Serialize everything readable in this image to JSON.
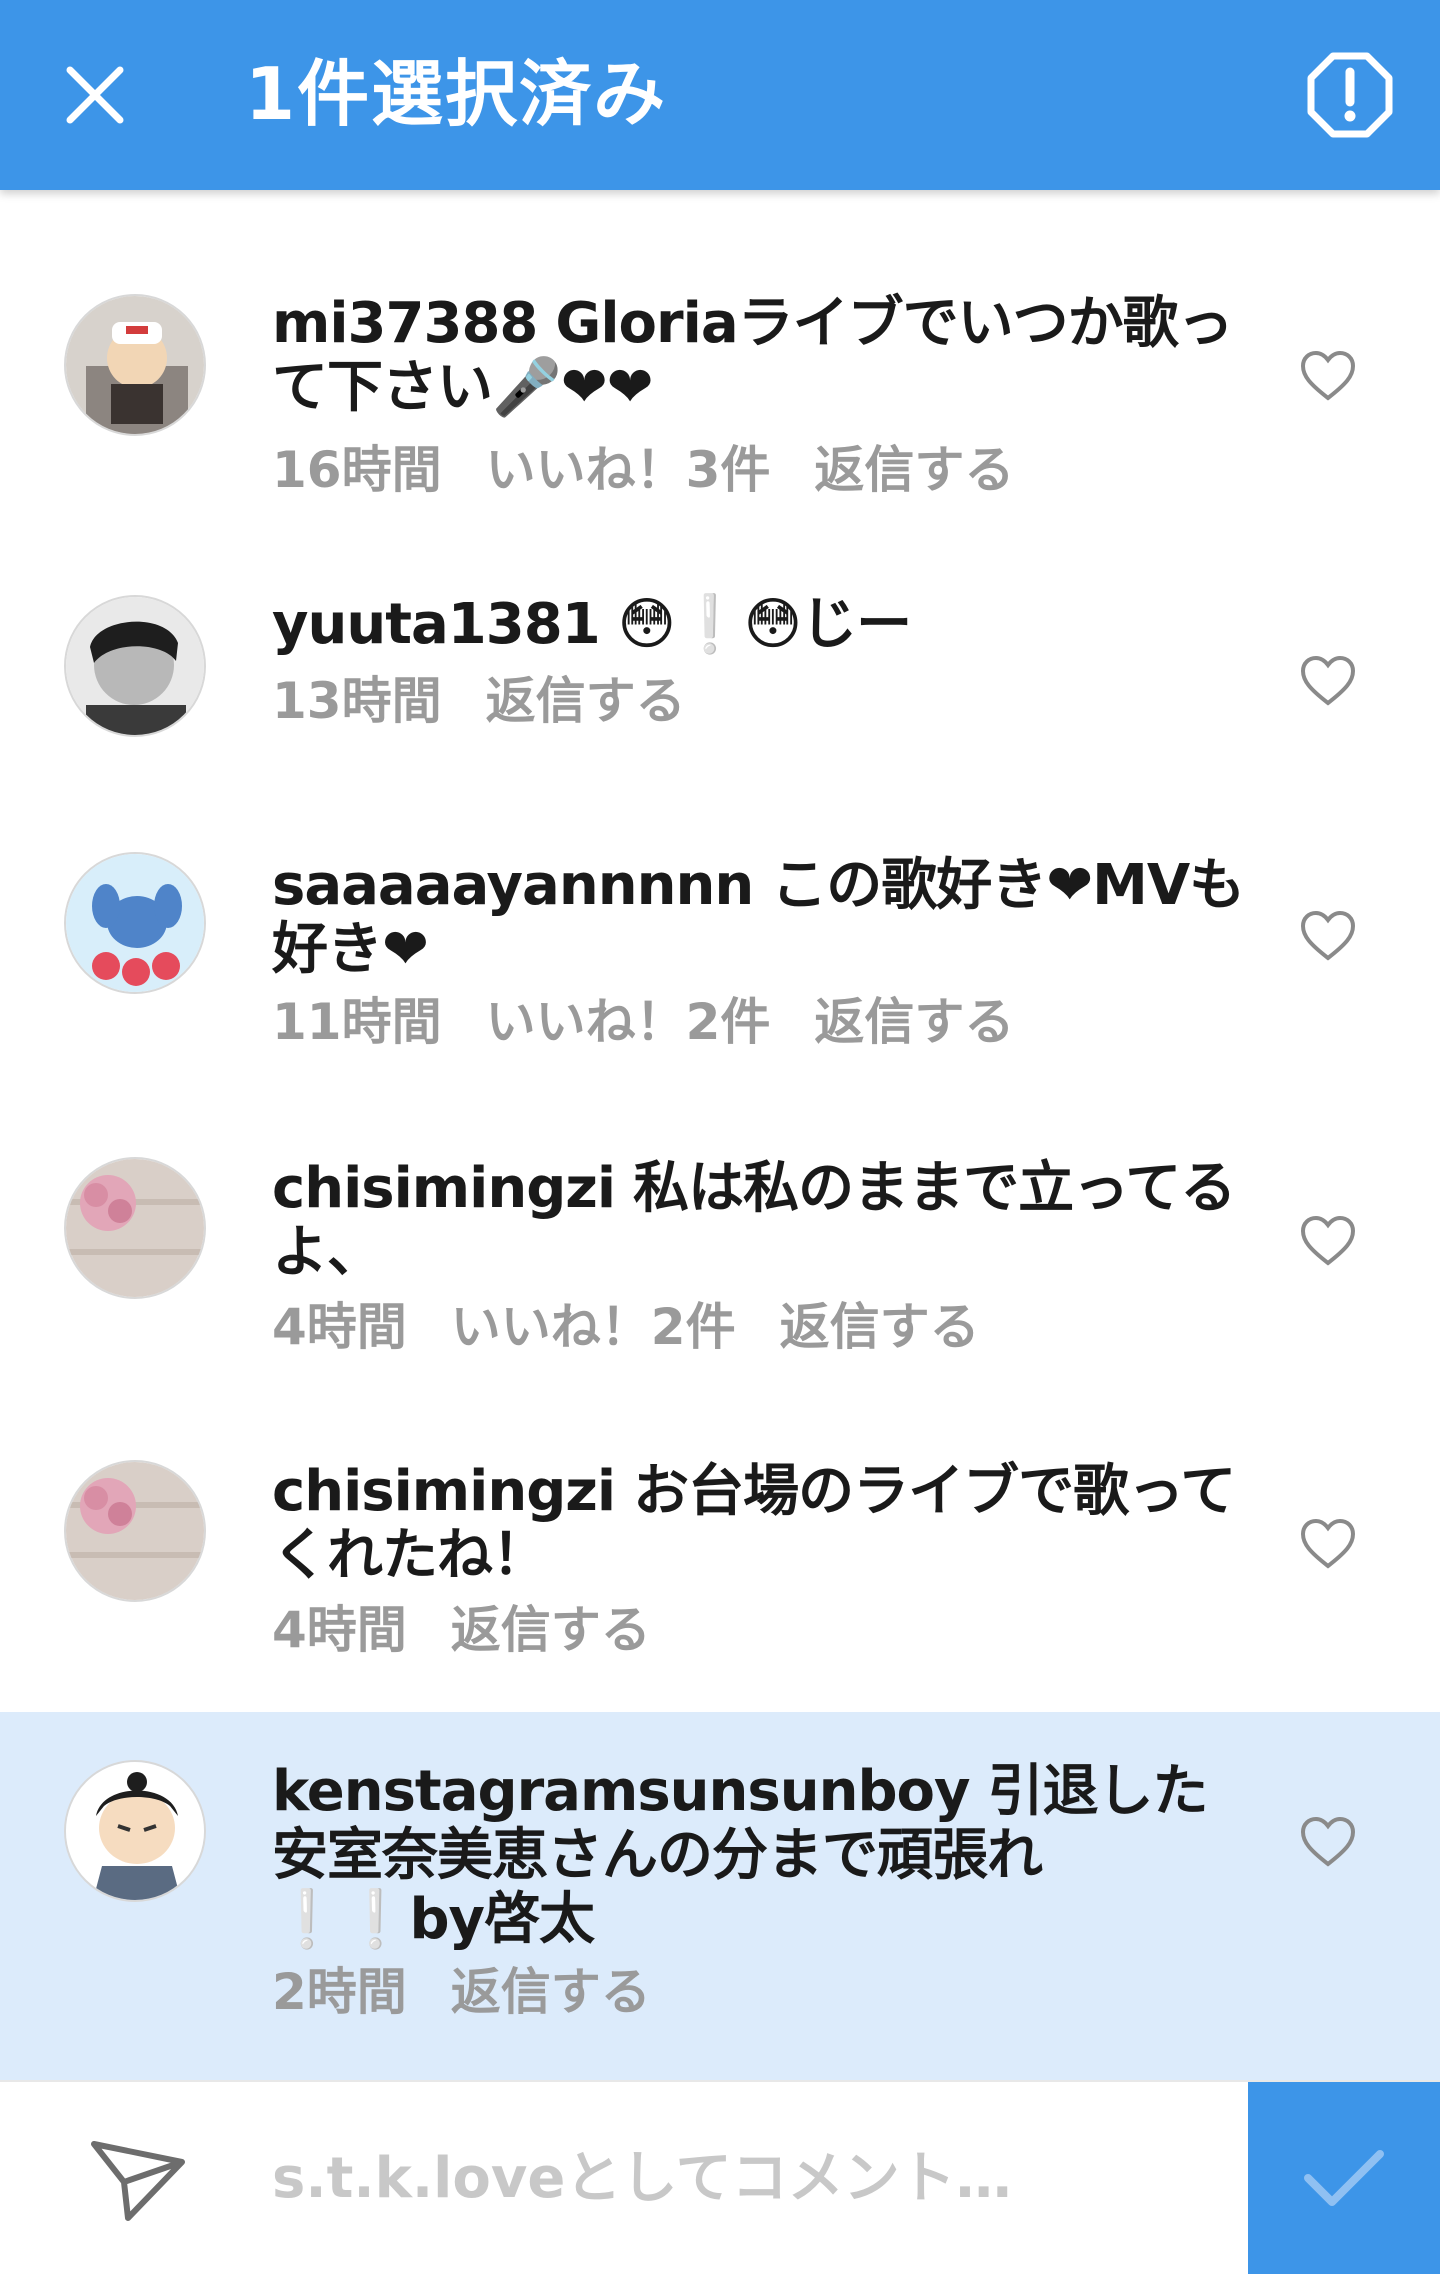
{
  "header": {
    "title": "1件選択済み",
    "close_icon": "close-icon",
    "report_icon": "report-icon"
  },
  "comments": [
    {
      "username": "mi37388",
      "text": "Gloriaライブでいつか歌って下さい🎤❤❤",
      "time": "16時間",
      "likes": "いいね！3件",
      "reply": "返信する"
    },
    {
      "username": "yuuta1381",
      "text": "😳❕😳じー",
      "time": "13時間",
      "reply": "返信する"
    },
    {
      "username": "saaaaayannnnn",
      "text": "この歌好き❤MVも好き❤",
      "time": "11時間",
      "likes": "いいね！2件",
      "reply": "返信する"
    },
    {
      "username": "chisimingzi",
      "text": "私は私のままで立ってるよ、",
      "time": "4時間",
      "likes": "いいね！2件",
      "reply": "返信する"
    },
    {
      "username": "chisimingzi",
      "text": "お台場のライブで歌ってくれたね！",
      "time": "4時間",
      "reply": "返信する"
    },
    {
      "username": "kenstagramsunsunboy",
      "text": "引退した安室奈美恵さんの分まで頑張れ❕❕by啓太",
      "time": "2時間",
      "reply": "返信する",
      "selected": true
    }
  ],
  "composer": {
    "placeholder": "s.t.k.loveとしてコメント…",
    "send_icon": "send-icon",
    "post_icon": "check-icon"
  },
  "colors": {
    "accent": "#3d95e8",
    "selected_row": "#dcebfb",
    "meta_text": "#9a9a9a",
    "heart_pink": "#e2558c",
    "exclaim_blue": "#4fb7e6"
  }
}
